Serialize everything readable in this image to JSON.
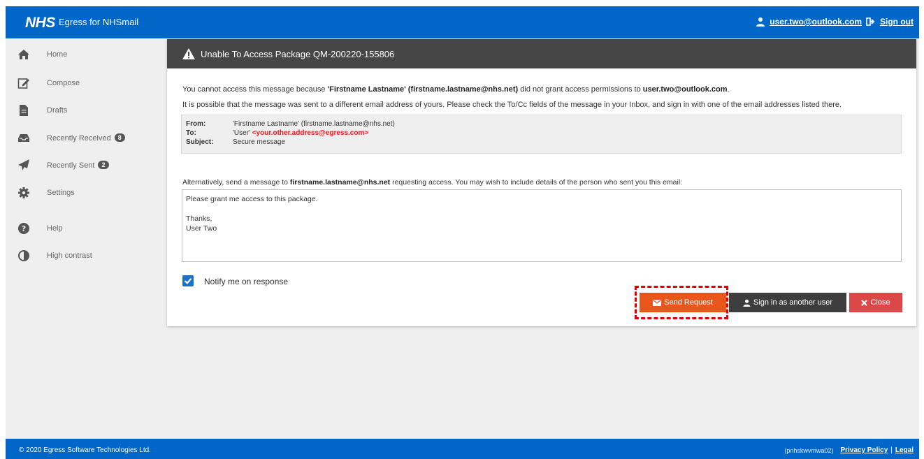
{
  "header": {
    "logo": "NHS",
    "app_title": "Egress for NHSmail",
    "user_email": "user.two@outlook.com",
    "sign_out": "Sign out"
  },
  "sidebar": {
    "items": [
      {
        "label": "Home",
        "icon": "home-icon"
      },
      {
        "label": "Compose",
        "icon": "compose-icon"
      },
      {
        "label": "Drafts",
        "icon": "drafts-icon"
      },
      {
        "label": "Recently Received",
        "icon": "inbox-icon",
        "badge": "8"
      },
      {
        "label": "Recently Sent",
        "icon": "send-icon",
        "badge": "2"
      },
      {
        "label": "Settings",
        "icon": "gear-icon"
      },
      {
        "label": "Help",
        "icon": "help-icon"
      },
      {
        "label": "High contrast",
        "icon": "contrast-icon"
      }
    ]
  },
  "dialog": {
    "title": "Unable To Access Package QM-200220-155806",
    "p1_pre": "You cannot access this message because ",
    "p1_sender": "'Firstname Lastname' (firstname.lastname@nhs.net)",
    "p1_mid": " did not grant access permissions to ",
    "p1_user": "user.two@outlook.com",
    "p1_end": ".",
    "p2": "It is possible that the message was sent to a different email address of yours. Please check the To/Cc fields of the message in your Inbox, and sign in with one of the email addresses listed there.",
    "message": {
      "from_label": "From:",
      "from_value": "'Firstname Lastname' (firstname.lastname@nhs.net)",
      "to_label": "To:",
      "to_name": "'User' ",
      "to_address": "<your.other.address@egress.com>",
      "subject_label": "Subject:",
      "subject_value": "Secure message"
    },
    "p3_pre": "Alternatively, send a message to ",
    "p3_address": "firstname.lastname@nhs.net",
    "p3_post": " requesting access. You may wish to include details of the person who sent you this email:",
    "request_text": "Please grant me access to this package.\n\nThanks,\nUser Two",
    "notify_label": "Notify me on response",
    "notify_checked": true,
    "buttons": {
      "send": "Send Request",
      "sign_in": "Sign in as another user",
      "close": "Close"
    }
  },
  "footer": {
    "copyright": "© 2020 Egress Software Technologies Ltd.",
    "host": "(pnhskwvmwa02)",
    "privacy": "Privacy Policy",
    "legal": "Legal"
  },
  "colors": {
    "nhs_blue": "#0066c8",
    "send_orange": "#e8561a",
    "close_red": "#dc4848",
    "dialog_header": "#464646"
  }
}
